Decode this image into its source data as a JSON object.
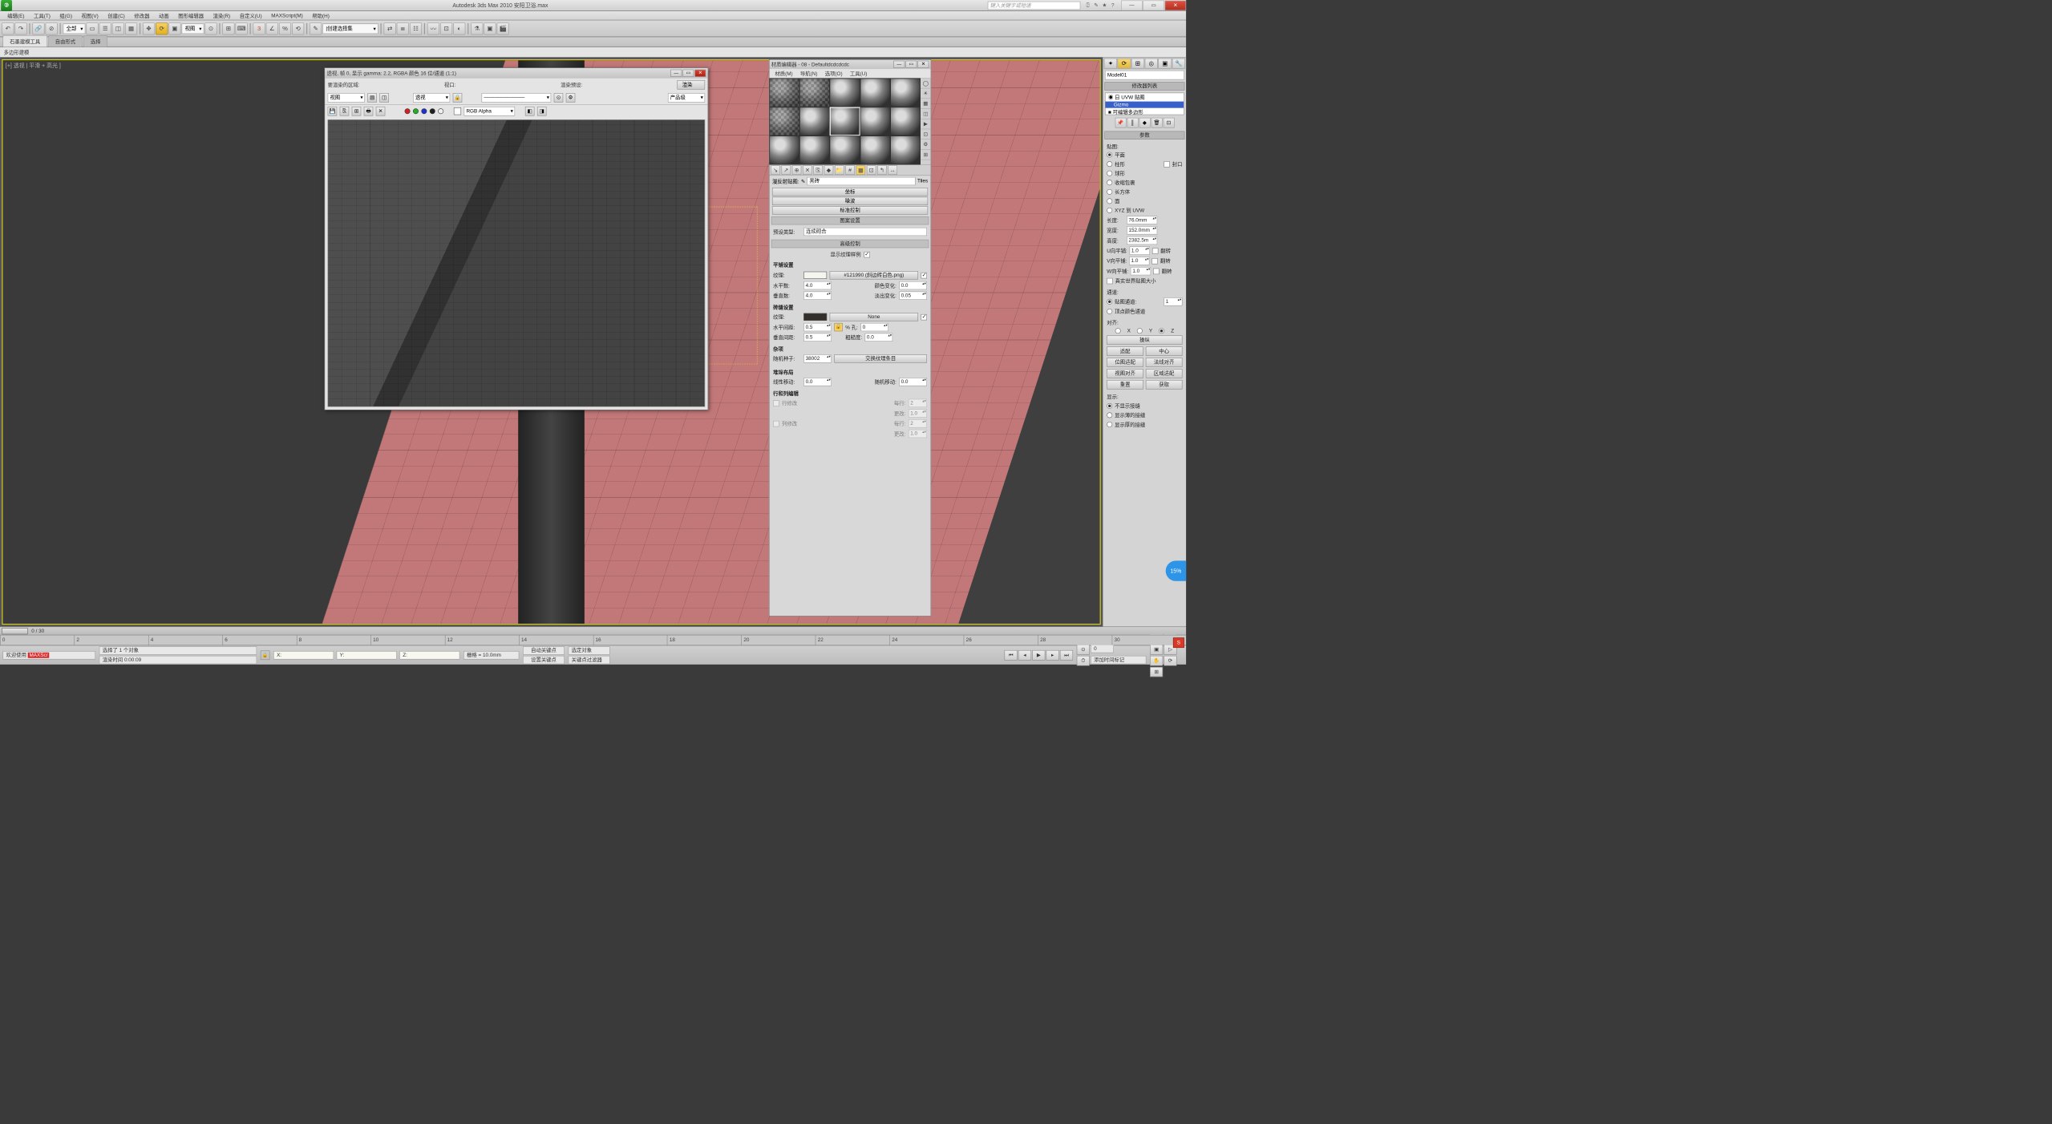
{
  "app": {
    "title": "Autodesk 3ds Max 2010   安阳卫浴.max",
    "search_placeholder": "键入关键字或短语"
  },
  "menus": [
    "编辑(E)",
    "工具(T)",
    "组(G)",
    "视图(V)",
    "创建(C)",
    "修改器",
    "动画",
    "图形编辑器",
    "渲染(R)",
    "自定义(U)",
    "MAXScript(M)",
    "帮助(H)"
  ],
  "toolbar": {
    "set_drop": "全部",
    "view_drop": "视图",
    "createsel_drop": "|创建选择集"
  },
  "ribbon": {
    "tabs": [
      "石墨建模工具",
      "自由形式",
      "选择"
    ],
    "sub": "多边形建模"
  },
  "viewport": {
    "label": "[+] 透视 | 平滑 + 高光 ]"
  },
  "timeline": {
    "range": "0 / 30",
    "ticks": [
      "0",
      "2",
      "4",
      "6",
      "8",
      "10",
      "12",
      "14",
      "16",
      "18",
      "20",
      "22",
      "24",
      "26",
      "28",
      "30"
    ]
  },
  "render_win": {
    "title": "透视, 帧 0, 显示 gamma: 2.2, RGBA 颜色 16 位/通道 (1:1)",
    "area_label": "要渲染的区域:",
    "area_drop": "视图",
    "viewport_label": "视口:",
    "viewport_drop": "透视",
    "preset_label": "渲染预设:",
    "preset_drop": "————————",
    "render_btn": "渲染",
    "production_drop": "产品级",
    "channel_drop": "RGB Alpha"
  },
  "mat_editor": {
    "title": "材质编辑器 - 08 - Defaultdcdcdcdc",
    "menus": [
      "材质(M)",
      "导航(N)",
      "选项(O)",
      "工具(U)"
    ],
    "reflect_label": "漫反射贴图:",
    "map_drop": "黑砖",
    "right_label": "Tiles",
    "btns": [
      "坐标",
      "噪波",
      "标准控制"
    ],
    "sec_pattern": "图案设置",
    "preset_type_label": "预设类型:",
    "preset_type_drop": "连续砌合",
    "sec_adv": "高级控制",
    "show_label": "显示纹理样例",
    "tile_header": "平铺设置",
    "texture_label": "纹理:",
    "texture_btn": "#121990 (斜边砖白色.png)",
    "h_count_label": "水平数:",
    "h_count": "4.0",
    "v_count_label": "垂直数:",
    "v_count": "4.0",
    "color_var_label": "颜色变化:",
    "color_var": "0.0",
    "fade_var_label": "淡出变化:",
    "fade_var": "0.05",
    "grout_header": "砖缝设置",
    "grout_tex_label": "纹理:",
    "grout_btn": "None",
    "h_gap_label": "水平间距:",
    "h_gap": "0.5",
    "v_gap_label": "垂直间距:",
    "v_gap": "0.5",
    "hole_label": "% 孔:",
    "hole": "0",
    "rough_label": "粗糙度:",
    "rough": "0.0",
    "misc_header": "杂项",
    "seed_label": "随机种子:",
    "seed": "38002",
    "swap_btn": "交换纹理条目",
    "stack_header": "堆垛布局",
    "line_shift_label": "线性移动:",
    "line_shift": "0.0",
    "rand_shift_label": "随机移动:",
    "rand_shift": "0.0",
    "rowcol_header": "行和列编辑",
    "row_mod_label": "行修改",
    "per_label": "每行:",
    "per_val": "2",
    "change_label": "更改:",
    "change_val": "1.0",
    "col_mod_label": "列修改",
    "per_val2": "2",
    "change_val2": "1.0"
  },
  "cmd": {
    "object_drop": "Model01",
    "list_header": "修改器列表",
    "mods": [
      "◉ 日 UVW 贴图",
      "Gizmo",
      "■ 可编辑多边形"
    ],
    "params_header": "参数",
    "map_label": "贴图:",
    "map_types": [
      "平面",
      "柱形",
      "球形",
      "收缩包裹",
      "长方体",
      "面",
      "XYZ 到 UVW"
    ],
    "cap_label": "封口",
    "length_label": "长度:",
    "length": "76.0mm",
    "width_label": "宽度:",
    "width": "152.0mm",
    "height_label": "高度:",
    "height": "2382.5m",
    "u_tile_label": "U向平铺:",
    "u_tile": "1.0",
    "v_tile_label": "V向平铺:",
    "v_tile": "1.0",
    "w_tile_label": "W向平铺:",
    "w_tile": "1.0",
    "flip_label": "翻转",
    "realworld_label": "真实世界贴图大小",
    "channel_header": "通道:",
    "map_channel_label": "贴图通道:",
    "map_channel": "1",
    "vertex_color_label": "顶点颜色通道",
    "align_header": "对齐:",
    "axes": [
      "X",
      "Y",
      "Z"
    ],
    "btns": {
      "manipulate": "操纵",
      "fit": "适配",
      "center": "中心",
      "bitmap_fit": "位图适配",
      "normal_align": "法线对齐",
      "view_align": "视图对齐",
      "region_fit": "区域适配",
      "reset": "重置",
      "acquire": "获取"
    },
    "display_header": "显示:",
    "display_opts": [
      "不显示接缝",
      "显示薄的接缝",
      "显示厚的接缝"
    ]
  },
  "status": {
    "welcome": "欢迎使用",
    "maxscript": "MAXScr",
    "sel_text": "选择了 1 个对象",
    "render_time_label": "渲染时间",
    "render_time": "0:00:09",
    "grid_label": "栅格 = 10.0mm",
    "autokey_label": "自动关键点",
    "selkey_label": "选定对象",
    "add_time_tag": "添加时间标记",
    "set_key": "设置关键点",
    "key_filters": "关键点过滤器",
    "frame": "0",
    "badge": "15%"
  }
}
